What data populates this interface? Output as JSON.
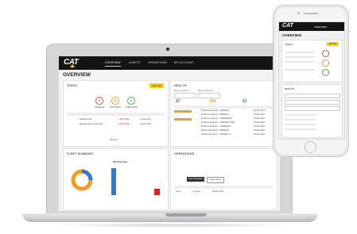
{
  "laptop": {
    "app": {
      "brand": "CAT",
      "nav": [
        "OVERVIEW",
        "ASSETS",
        "OPERATIONS",
        "MY ACCOUNT"
      ],
      "page_title": "OVERVIEW"
    },
    "tasks": {
      "title": "TASKS",
      "add_button": "Add Task",
      "rings": [
        {
          "value": "0",
          "label": "OVERDUE",
          "color": "#e5533c"
        },
        {
          "value": "0",
          "label": "UPCOMING",
          "color": "#f59a23"
        },
        {
          "value": "0",
          "label": "COMPLETED",
          "color": "#4caf50"
        }
      ],
      "rows": [
        {
          "name": "Schedule PM",
          "status": "PAST DUE",
          "date": "07-Feb-2017"
        },
        {
          "name": "Change oil at service level",
          "status": "PAST DUE",
          "date": "07-Feb-2017"
        }
      ],
      "footer": "VIEW ALL"
    },
    "health": {
      "title": "HEALTH",
      "filter1": "Filter by Severity",
      "filter2": "Filter by Category",
      "stats": [
        {
          "value": "17",
          "color": "#d22"
        },
        {
          "value": "154",
          "color": "#f59a23"
        },
        {
          "value": "62",
          "color": "#3a78c4"
        }
      ],
      "rows": [
        "Product Link Event - 4229F10E",
        "Product Link Event - 5290F344",
        "Product Link Event - 714DD4BA52",
        "Product Link Event - 714DD3DT 3690",
        "Product Link Event - 73F4D2G92",
        "Product Link Event - 5096D975",
        "Product Link Event - 73F4D4A 2C"
      ],
      "dates": [
        "25-Feb-2017",
        "25-Feb-2017",
        "25-Feb-2017",
        "25-Feb-2017",
        "25-Feb-2017",
        "25-Feb-2017",
        "25-Feb-2017"
      ]
    },
    "fleet": {
      "title": "FLEET SUMMARY",
      "total": "185 Total Assets"
    },
    "operations": {
      "title": "OPERATIONS",
      "btn1": "Show Operations",
      "btn2": "Report Hours",
      "row": [
        "Hours",
        "2.7 Hours",
        "03-Feb-2017"
      ]
    }
  },
  "phone": {
    "brand": "CAT",
    "nav_active": "OVERVIEW",
    "page_title": "OVERVIEW",
    "tasks_title": "TASKS",
    "health_title": "HEALTH",
    "add_button": "Add Task"
  }
}
